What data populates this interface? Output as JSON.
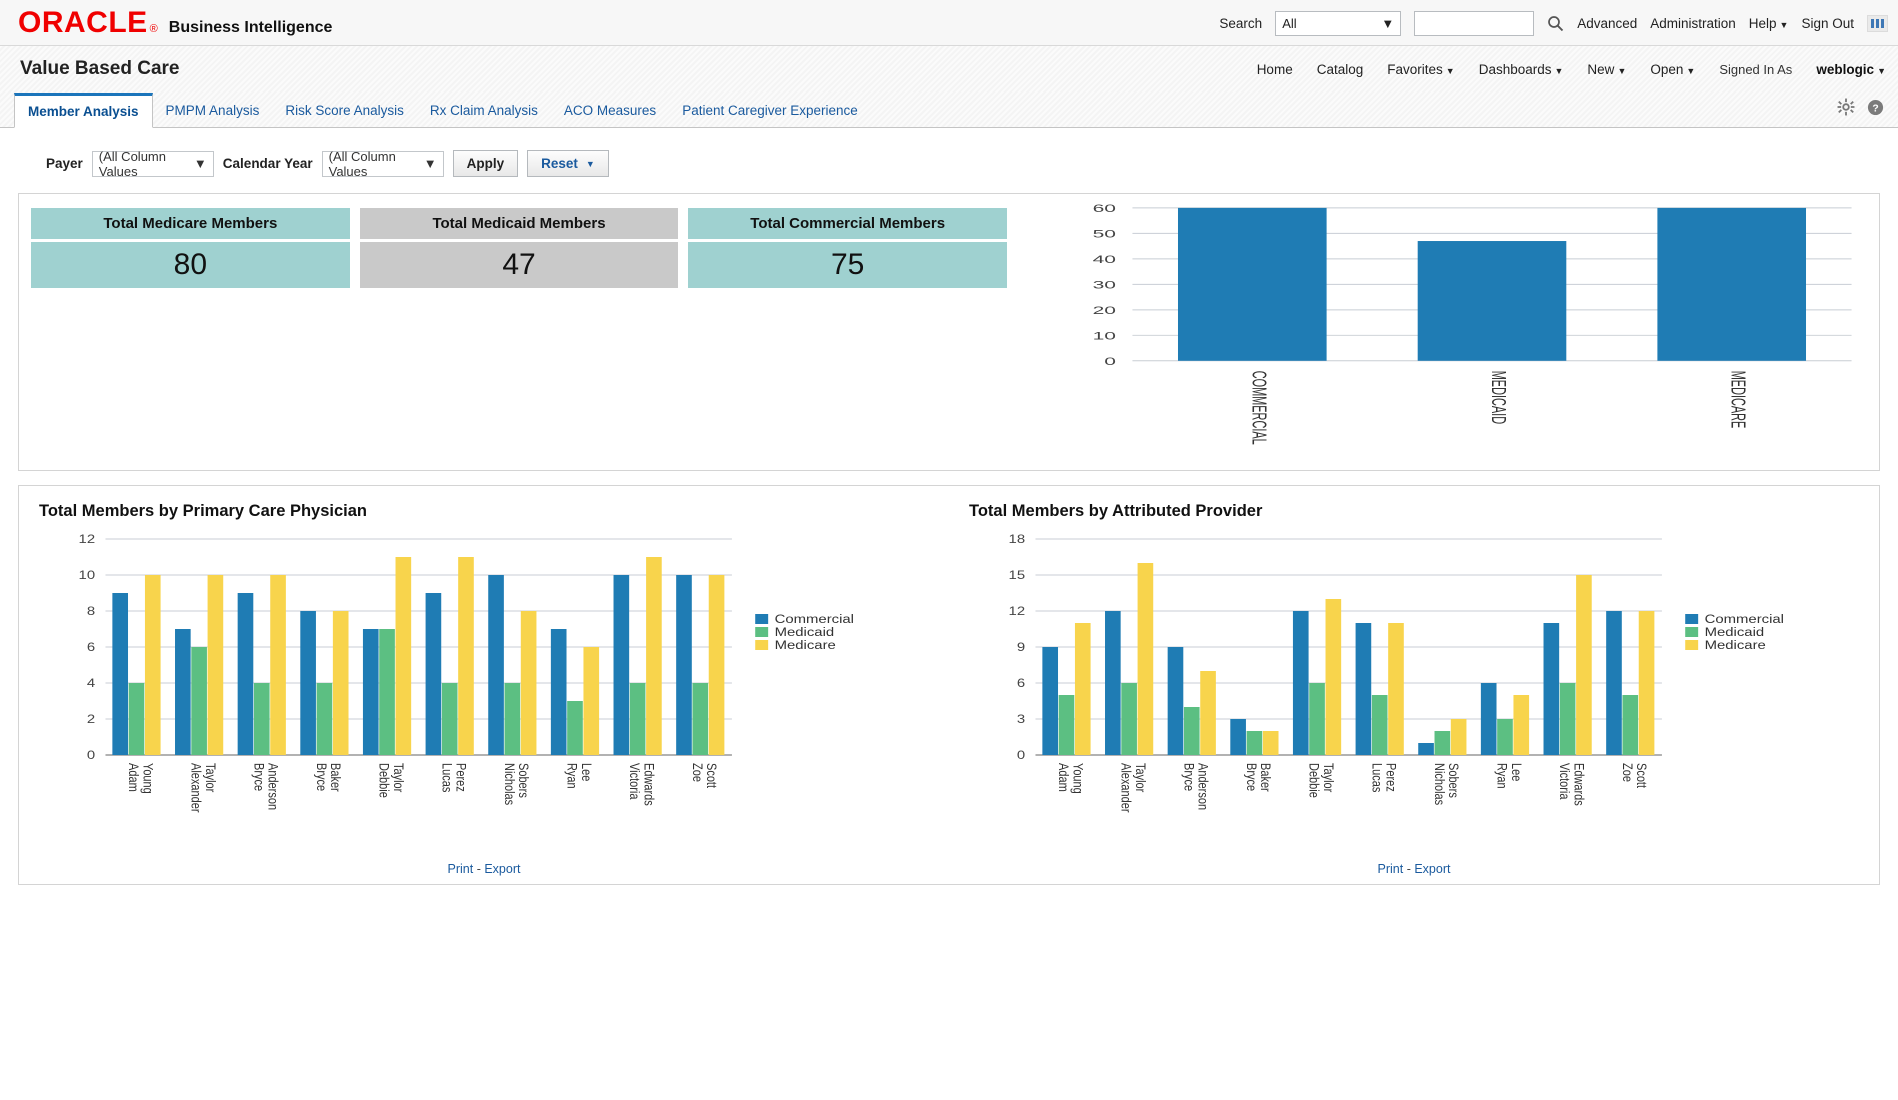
{
  "brand": {
    "logo_text": "ORACLE",
    "logo_tm": "®",
    "product": "Business Intelligence"
  },
  "header": {
    "search_label": "Search",
    "search_scope": "All",
    "search_placeholder": "",
    "search_value": "",
    "search_icon": "search-icon",
    "links": [
      {
        "label": "Advanced",
        "caret": false
      },
      {
        "label": "Administration",
        "caret": false
      },
      {
        "label": "Help",
        "caret": true
      },
      {
        "label": "Sign Out",
        "caret": false
      }
    ],
    "app_grid_icon": "grid-icon"
  },
  "dashboard": {
    "title": "Value Based Care",
    "nav": [
      {
        "label": "Home",
        "caret": false
      },
      {
        "label": "Catalog",
        "caret": false
      },
      {
        "label": "Favorites",
        "caret": true
      },
      {
        "label": "Dashboards",
        "caret": true
      },
      {
        "label": "New",
        "caret": true
      },
      {
        "label": "Open",
        "caret": true
      }
    ],
    "signed_in_as_label": "Signed In As",
    "user": "weblogic",
    "gear_icon": "gear-icon",
    "help_icon": "help-icon"
  },
  "tabs": [
    {
      "label": "Member Analysis",
      "active": true
    },
    {
      "label": "PMPM Analysis",
      "active": false
    },
    {
      "label": "Risk Score Analysis",
      "active": false
    },
    {
      "label": "Rx Claim Analysis",
      "active": false
    },
    {
      "label": "ACO Measures",
      "active": false
    },
    {
      "label": "Patient Caregiver Experience",
      "active": false
    }
  ],
  "filters": {
    "payer_label": "Payer",
    "payer_value": "(All Column Values",
    "year_label": "Calendar Year",
    "year_value": "(All Column Values",
    "apply_label": "Apply",
    "reset_label": "Reset"
  },
  "kpis": [
    {
      "title": "Total Medicare Members",
      "value": "80",
      "color": "#9fd1d0"
    },
    {
      "title": "Total Medicaid Members",
      "value": "47",
      "color": "#c9c9c9"
    },
    {
      "title": "Total Commercial Members",
      "value": "75",
      "color": "#9fd1d0"
    }
  ],
  "colors": {
    "commercial": "#1f7cb4",
    "medicaid": "#5cbf82",
    "medicare": "#f8d44c",
    "teal": "#9fd1d0",
    "grey": "#c9c9c9",
    "link": "#1a5a9e"
  },
  "chart_data": [
    {
      "id": "payer-bar",
      "type": "bar",
      "title": "",
      "categories": [
        "COMMERCIAL",
        "MEDICAID",
        "MEDICARE"
      ],
      "values": [
        60,
        47,
        60
      ],
      "xlabel": "",
      "ylabel": "",
      "ylim": [
        0,
        60
      ],
      "yticks": [
        0,
        10,
        20,
        30,
        40,
        50,
        60
      ],
      "grid": true,
      "legend": "none",
      "series_color": "#1f7cb4"
    },
    {
      "id": "members-by-pcp",
      "type": "bar",
      "title": "Total Members by Primary Care Physician",
      "categories": [
        "Adam Young",
        "Alexander Taylor",
        "Bryce Anderson",
        "Bryce Baker",
        "Debbie Taylor",
        "Lucas Perez",
        "Nicholas Sobers",
        "Ryan Lee",
        "Victoria Edwards",
        "Zoe Scott"
      ],
      "series": [
        {
          "name": "Commercial",
          "color": "#1f7cb4",
          "values": [
            9,
            7,
            9,
            8,
            7,
            9,
            10,
            7,
            10,
            10
          ]
        },
        {
          "name": "Medicaid",
          "color": "#5cbf82",
          "values": [
            4,
            6,
            4,
            4,
            7,
            4,
            4,
            3,
            4,
            4
          ]
        },
        {
          "name": "Medicare",
          "color": "#f8d44c",
          "values": [
            10,
            10,
            10,
            8,
            11,
            11,
            8,
            6,
            11,
            10
          ]
        }
      ],
      "xlabel": "",
      "ylabel": "",
      "ylim": [
        0,
        12
      ],
      "yticks": [
        0,
        2,
        4,
        6,
        8,
        10,
        12
      ],
      "grid": true,
      "legend": "right",
      "footer": {
        "print": "Print",
        "sep": "-",
        "export": "Export"
      }
    },
    {
      "id": "members-by-attributed-provider",
      "type": "bar",
      "title": "Total Members by Attributed Provider",
      "categories": [
        "Adam Young",
        "Alexander Taylor",
        "Bryce Anderson",
        "Bryce Baker",
        "Debbie Taylor",
        "Lucas Perez",
        "Nicholas Sobers",
        "Ryan Lee",
        "Victoria Edwards",
        "Zoe Scott"
      ],
      "series": [
        {
          "name": "Commercial",
          "color": "#1f7cb4",
          "values": [
            9,
            12,
            9,
            3,
            12,
            11,
            1,
            6,
            11,
            12
          ]
        },
        {
          "name": "Medicaid",
          "color": "#5cbf82",
          "values": [
            5,
            6,
            4,
            2,
            6,
            5,
            2,
            3,
            6,
            5
          ]
        },
        {
          "name": "Medicare",
          "color": "#f8d44c",
          "values": [
            11,
            16,
            7,
            2,
            13,
            11,
            3,
            5,
            15,
            12
          ]
        }
      ],
      "xlabel": "",
      "ylabel": "",
      "ylim": [
        0,
        18
      ],
      "yticks": [
        0,
        3,
        6,
        9,
        12,
        15,
        18
      ],
      "grid": true,
      "legend": "right",
      "footer": {
        "print": "Print",
        "sep": "-",
        "export": "Export"
      }
    }
  ]
}
